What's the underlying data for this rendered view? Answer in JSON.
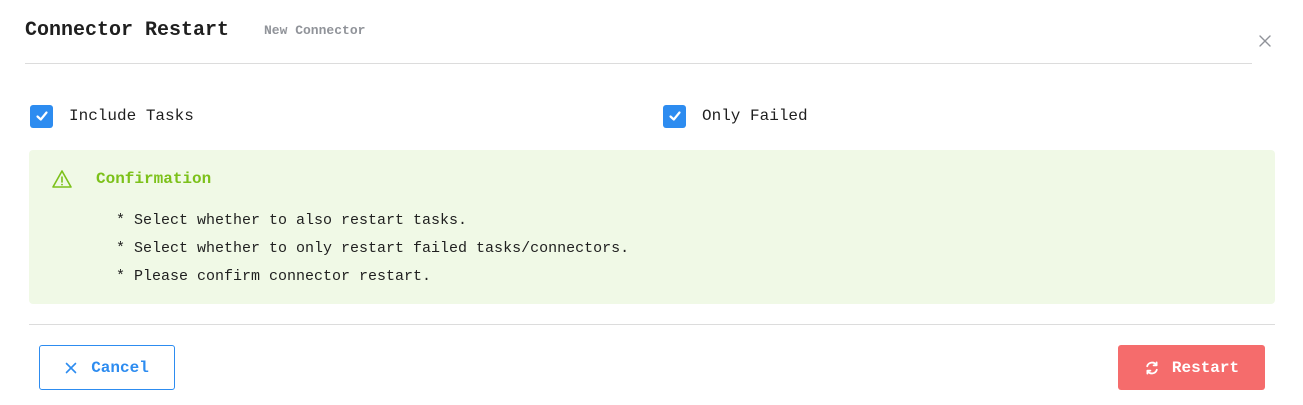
{
  "dialog": {
    "title": "Connector Restart",
    "subtitle": "New Connector",
    "close_icon": "close-icon"
  },
  "options": {
    "include_tasks": {
      "label": "Include Tasks",
      "checked": true
    },
    "only_failed": {
      "label": "Only Failed",
      "checked": true
    }
  },
  "alert": {
    "icon": "warning-triangle-icon",
    "title": "Confirmation",
    "items": [
      "* Select whether to also restart tasks.",
      "* Select whether to only restart failed tasks/connectors.",
      "* Please confirm connector restart."
    ]
  },
  "footer": {
    "cancel_label": "Cancel",
    "cancel_icon": "close-icon",
    "restart_label": "Restart",
    "restart_icon": "refresh-icon"
  },
  "colors": {
    "primary": "#2d8cf0",
    "danger": "#f56c6c",
    "success_text": "#7cc11a",
    "success_bg": "#f0f9e6",
    "subtitle": "#909399"
  }
}
